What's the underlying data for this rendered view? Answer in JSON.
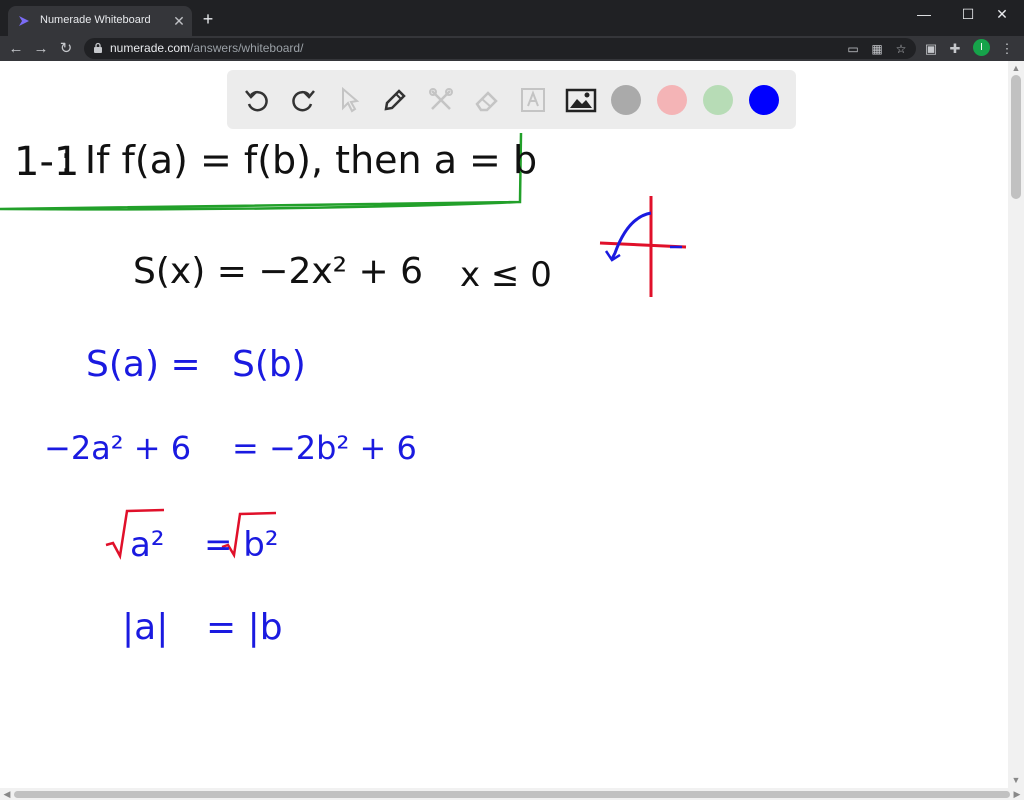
{
  "browser": {
    "tab_title": "Numerade Whiteboard",
    "tab_close": "✕",
    "new_tab": "+",
    "url_host": "numerade.com",
    "url_path": "/answers/whiteboard/",
    "profile_initial": "I",
    "window": {
      "minimize": "—",
      "maximize": "☐",
      "close": "✕"
    }
  },
  "whiteboard": {
    "tools": [
      "undo-icon",
      "redo-icon",
      "select-icon",
      "pen-icon",
      "tools-icon",
      "eraser-icon",
      "text-icon",
      "image-icon"
    ],
    "colors": {
      "gray": "#aaaaaa",
      "red": "#f4b4b6",
      "green": "#b7dcb6",
      "blue": "#0000ff"
    },
    "ink": {
      "green": "#22a02a",
      "black": "#111111",
      "blue": "#1a1ae0",
      "red": "#e0102a"
    },
    "lines": {
      "definition_label": "1-1",
      "definition_text": ": If  f(a) = f(b), then  a = b",
      "function": "S(x) = −2x² + 6",
      "domain": "x ≤ 0",
      "step1_left": "S(a) =",
      "step1_right": "S(b)",
      "step2_left": "−2a² + 6",
      "step2_right": "= −2b² + 6",
      "step3_left": "a²",
      "step3_right": "= b²",
      "step4_left": "|a|",
      "step4_right": "= |b"
    }
  }
}
